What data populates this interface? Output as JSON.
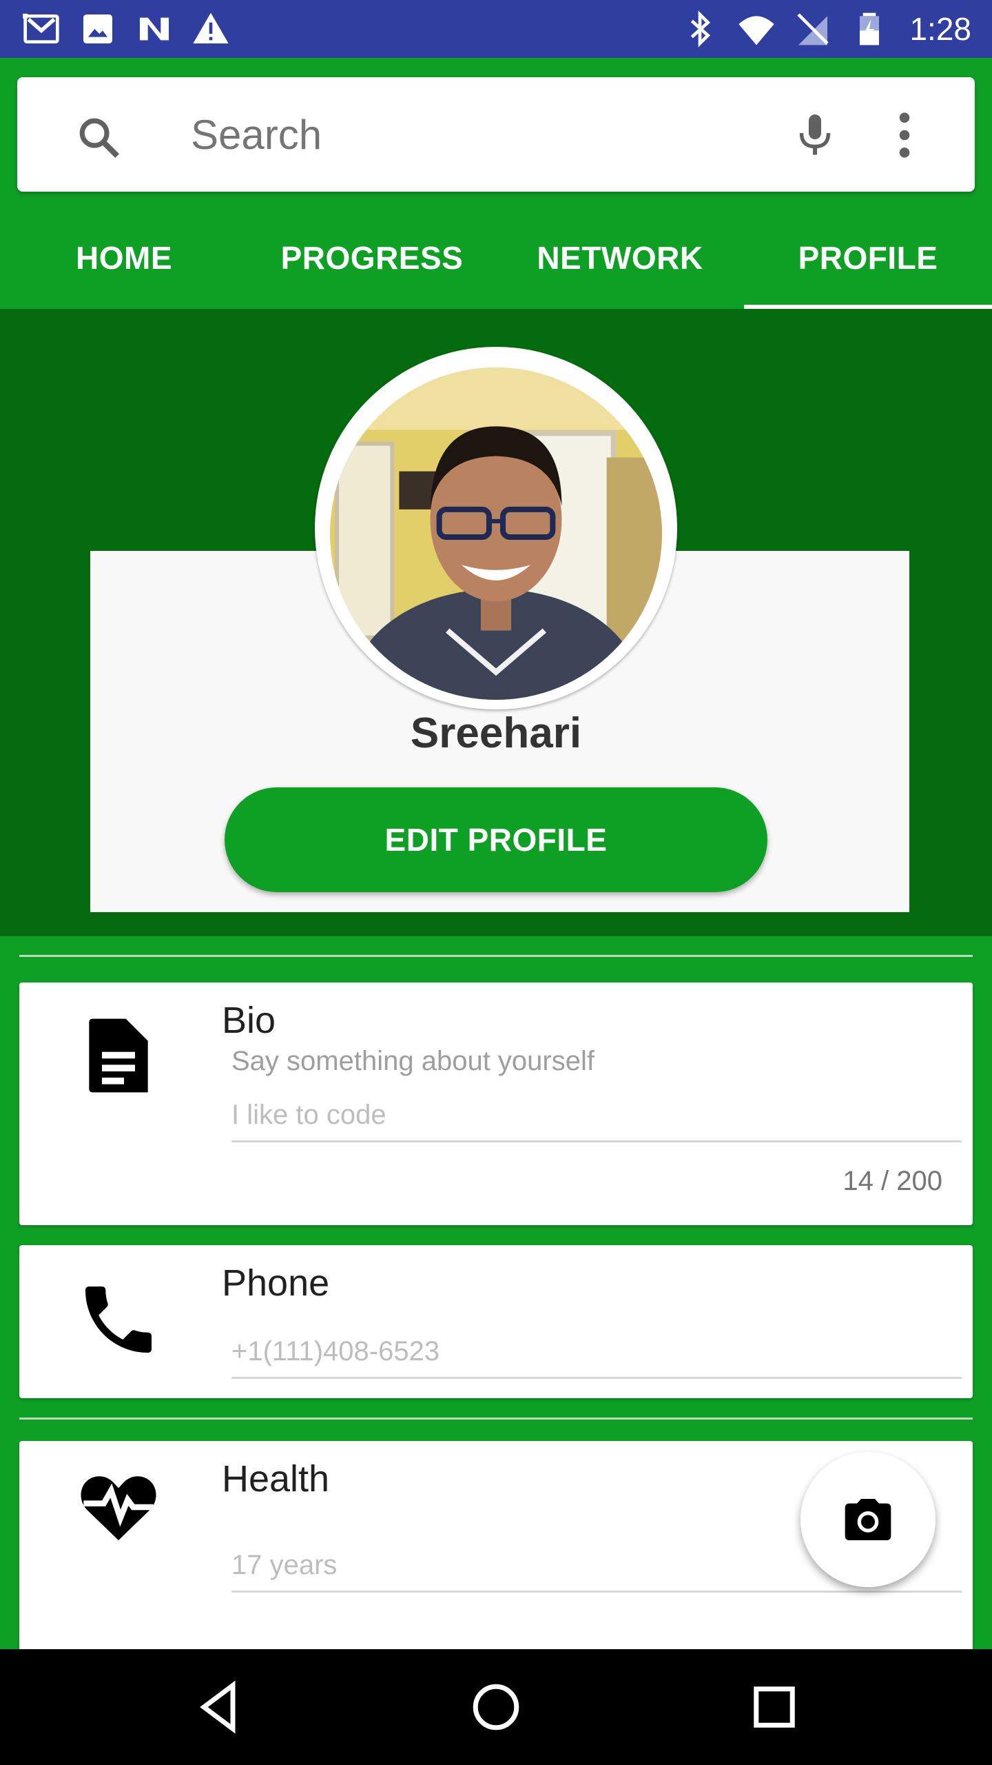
{
  "status_bar": {
    "time": "1:28",
    "left_icons": [
      "gmail-icon",
      "image-icon",
      "n-app-icon",
      "warning-icon"
    ],
    "right_icons": [
      "bluetooth-icon",
      "wifi-icon",
      "no-sim-icon",
      "battery-charging-icon"
    ]
  },
  "search": {
    "placeholder": "Search"
  },
  "tabs": [
    {
      "label": "HOME",
      "active": false
    },
    {
      "label": "PROGRESS",
      "active": false
    },
    {
      "label": "NETWORK",
      "active": false
    },
    {
      "label": "PROFILE",
      "active": true
    }
  ],
  "profile": {
    "name": "Sreehari",
    "edit_button": "EDIT PROFILE"
  },
  "bio": {
    "title": "Bio",
    "hint": "Say something about yourself",
    "value": "I like to code",
    "counter": "14 / 200"
  },
  "phone": {
    "title": "Phone",
    "value": "+1(111)408-6523"
  },
  "health": {
    "title": "Health",
    "value": "17 years"
  },
  "colors": {
    "status_bar": "#303f9f",
    "primary_green": "#0e9f25",
    "dark_green": "#056b0f",
    "card_bg": "#ffffff"
  }
}
